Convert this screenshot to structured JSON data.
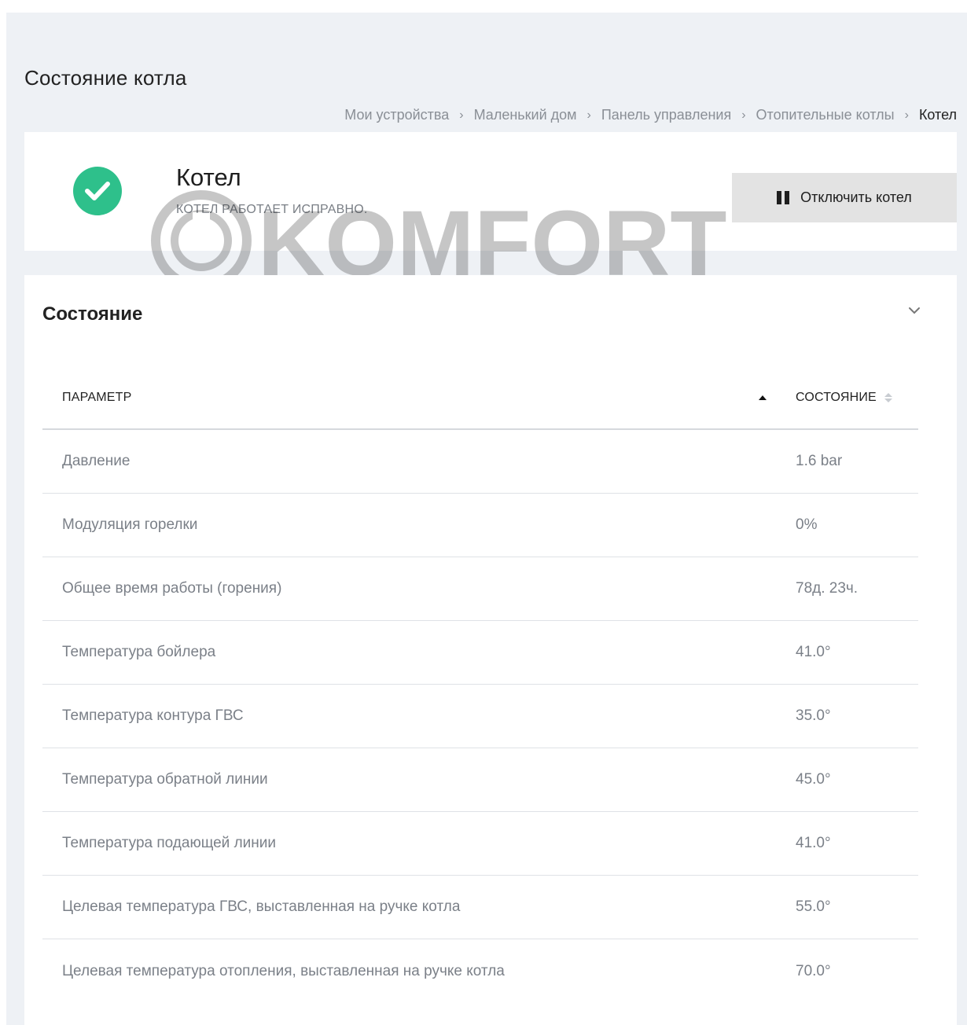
{
  "page": {
    "title": "Состояние котла"
  },
  "breadcrumb": [
    "Мои устройства",
    "Маленький дом",
    "Панель управления",
    "Отопительные котлы",
    "Котел"
  ],
  "device": {
    "name": "Котел",
    "status_text": "КОТЕЛ РАБОТАЕТ ИСПРАВНО.",
    "status_icon": "check-circle-icon",
    "status_color": "#2ec08b",
    "toggle_label": "Отключить котел"
  },
  "watermark": {
    "text": "KOMFORT"
  },
  "section": {
    "title": "Состояние",
    "columns": {
      "param": "ПАРАМЕТР",
      "state": "СОСТОЯНИЕ"
    },
    "rows": [
      {
        "param": "Давление",
        "state": "1.6 bar"
      },
      {
        "param": "Модуляция горелки",
        "state": "0%"
      },
      {
        "param": "Общее время работы (горения)",
        "state": "78д. 23ч."
      },
      {
        "param": "Температура бойлера",
        "state": "41.0°"
      },
      {
        "param": "Температура контура ГВС",
        "state": "35.0°"
      },
      {
        "param": "Температура обратной линии",
        "state": "45.0°"
      },
      {
        "param": "Температура подающей линии",
        "state": "41.0°"
      },
      {
        "param": "Целевая температура ГВС, выставленная на ручке котла",
        "state": "55.0°"
      },
      {
        "param": "Целевая температура отопления, выставленная на ручке котла",
        "state": "70.0°"
      }
    ]
  }
}
